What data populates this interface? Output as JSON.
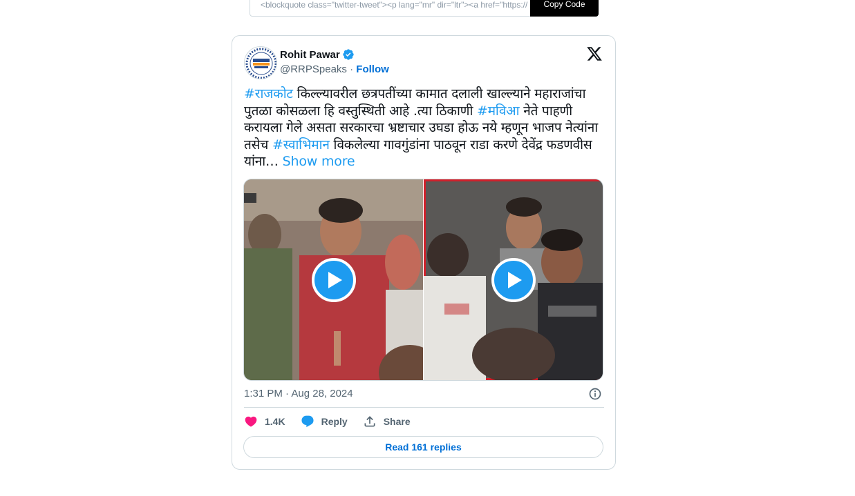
{
  "embed": {
    "code_snippet": "<blockquote class=\"twitter-tweet\"><p lang=\"mr\" dir=\"ltr\"><a href=\"https://",
    "copy_label": "Copy Code"
  },
  "tweet": {
    "author_name": "Rohit Pawar",
    "verified": true,
    "handle": "@RRPSpeaks",
    "separator": " · ",
    "follow_label": "Follow",
    "text_segments": [
      {
        "t": "#राजकोट",
        "tag": true
      },
      {
        "t": " किल्ल्यावरील छत्रपतींच्या कामात दलाली खाल्ल्याने महाराजांचा पुतळा कोसळला हि वस्तुस्थिती आहे .त्या ठिकाणी ",
        "tag": false
      },
      {
        "t": "#मविआ",
        "tag": true
      },
      {
        "t": " नेते पाहणी करायला गेले असता सरकारचा भ्रष्टाचार उघडा होऊ नये म्हणून भाजप नेत्यांना तसेच ",
        "tag": false
      },
      {
        "t": "#स्वाभिमान",
        "tag": true
      },
      {
        "t": " विकलेल्या गावगुंडांना पाठवून राडा करणे देवेंद्र फडणवीस यांना",
        "tag": false
      }
    ],
    "ellipsis": "… ",
    "show_more_label": "Show more",
    "timestamp": "1:31 PM · Aug 28, 2024",
    "likes": "1.4K",
    "reply_label": "Reply",
    "share_label": "Share",
    "read_replies_label": "Read 161 replies"
  },
  "colors": {
    "accent": "#1d9bf0",
    "link": "#006fd6",
    "like": "#f91880",
    "muted": "#536471",
    "border": "#cfd9de"
  },
  "icons": [
    "x-logo-icon",
    "verified-badge-icon",
    "play-icon",
    "info-icon",
    "heart-icon",
    "reply-icon",
    "share-icon"
  ]
}
